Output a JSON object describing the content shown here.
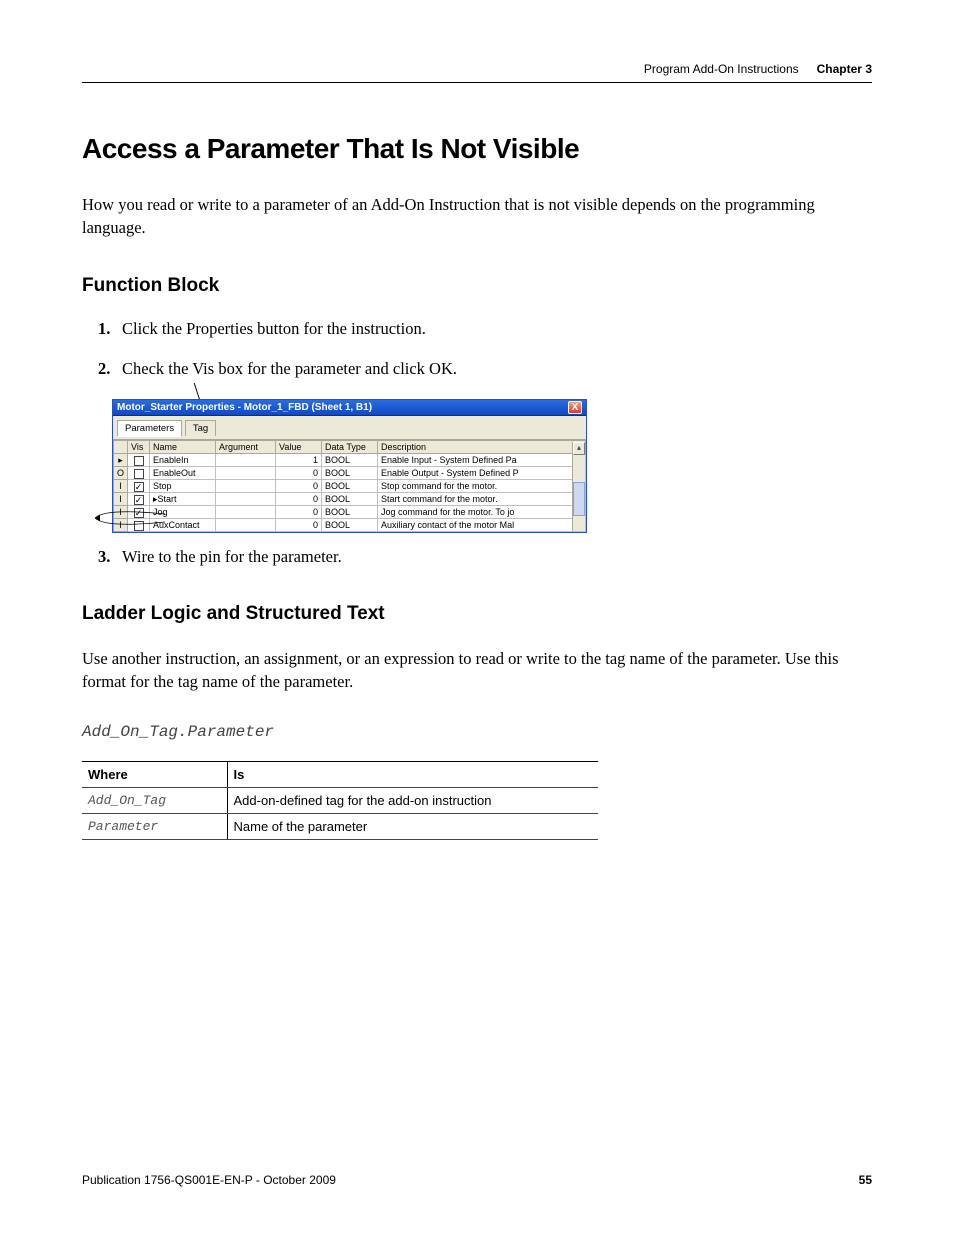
{
  "header": {
    "section": "Program Add-On Instructions",
    "chapter": "Chapter 3"
  },
  "h1": "Access a Parameter That Is Not Visible",
  "intro": "How you read or write to a parameter of an Add-On Instruction that is not visible depends on the programming language.",
  "h2_fb": "Function Block",
  "steps_fb": {
    "1": "Click the Properties button for the instruction.",
    "2": "Check the Vis box for the parameter and click OK.",
    "3": "Wire to the pin for the parameter."
  },
  "dialog": {
    "title": "Motor_Starter Properties - Motor_1_FBD (Sheet 1, B1)",
    "close_x": "X",
    "tabs": {
      "parameters": "Parameters",
      "tag": "Tag"
    },
    "columns": {
      "vis": "Vis",
      "name": "Name",
      "argument": "Argument",
      "value": "Value",
      "data_type": "Data Type",
      "description": "Description"
    },
    "rows": [
      {
        "rhead": "▸",
        "vis": false,
        "name": "EnableIn",
        "argument": "",
        "value": "1",
        "data_type": "BOOL",
        "description": "Enable Input - System Defined Pa"
      },
      {
        "rhead": "O",
        "vis": false,
        "name": "EnableOut",
        "argument": "",
        "value": "0",
        "data_type": "BOOL",
        "description": "Enable Output - System Defined P"
      },
      {
        "rhead": "I",
        "vis": true,
        "name": "Stop",
        "argument": "",
        "value": "0",
        "data_type": "BOOL",
        "description": "Stop command for the motor."
      },
      {
        "rhead": "I",
        "vis": true,
        "name": "Start",
        "argument": "",
        "value": "0",
        "data_type": "BOOL",
        "description": "Start command for the motor."
      },
      {
        "rhead": "I",
        "vis": true,
        "name": "Jog",
        "argument": "",
        "value": "0",
        "data_type": "BOOL",
        "description": "Jog command for the motor.  To jo"
      },
      {
        "rhead": "I",
        "vis": false,
        "name": "AuxContact",
        "argument": "",
        "value": "0",
        "data_type": "BOOL",
        "description": "Auxiliary contact of the motor  Mal"
      }
    ],
    "scroll_up": "▴"
  },
  "h2_lder": "Ladder Logic and Structured Text",
  "lder_text": "Use another instruction, an assignment, or an expression to read or write to the tag name of the parameter. Use this format for the tag name of the parameter.",
  "code_line": "Add_On_Tag.Parameter",
  "wi_table": {
    "head_where": "Where",
    "head_is": "Is",
    "rows": [
      {
        "where": "Add_On_Tag",
        "is": "Add-on-defined tag for the add-on instruction"
      },
      {
        "where": "Parameter",
        "is": "Name of the parameter"
      }
    ]
  },
  "footer": {
    "pub": "Publication 1756-QS001E-EN-P - October 2009",
    "page": "55"
  }
}
